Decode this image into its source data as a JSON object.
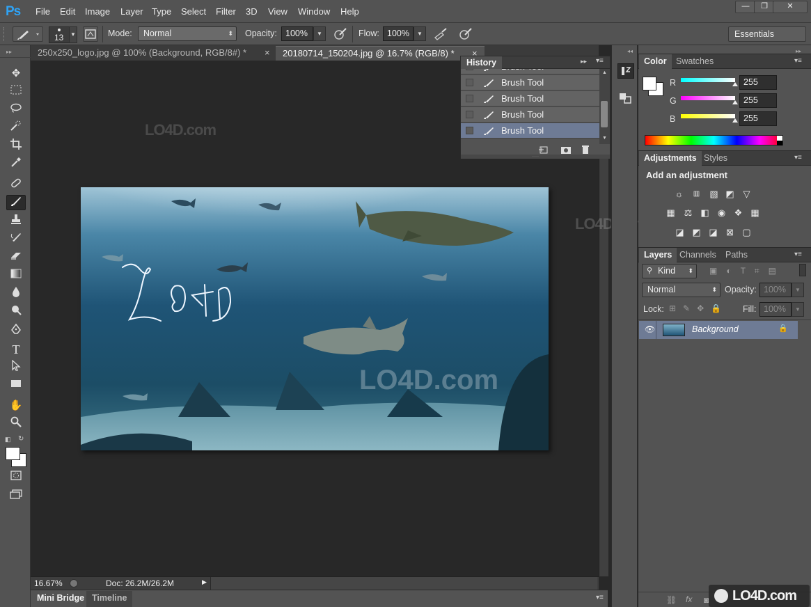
{
  "app": {
    "logo": "Ps"
  },
  "menu": [
    "File",
    "Edit",
    "Image",
    "Layer",
    "Type",
    "Select",
    "Filter",
    "3D",
    "View",
    "Window",
    "Help"
  ],
  "window_controls": {
    "minimize": "—",
    "restore": "❐",
    "close": "✕"
  },
  "options": {
    "brush_size": "13",
    "mode_label": "Mode:",
    "mode_value": "Normal",
    "opacity_label": "Opacity:",
    "opacity_value": "100%",
    "flow_label": "Flow:",
    "flow_value": "100%",
    "workspace": "Essentials"
  },
  "doc_tabs": [
    {
      "label": "250x250_logo.jpg @ 100% (Background, RGB/8#) *",
      "close": "×"
    },
    {
      "label": "20180714_150204.jpg @ 16.7% (RGB/8) *",
      "close": "×"
    }
  ],
  "status": {
    "zoom": "16.67%",
    "doc": "Doc: 26.2M/26.2M"
  },
  "bottom_tabs": [
    "Mini Bridge",
    "Timeline"
  ],
  "history": {
    "title": "History",
    "rows": [
      "Brush Tool",
      "Brush Tool",
      "Brush Tool",
      "Brush Tool",
      "Brush Tool"
    ],
    "selected_index": 4
  },
  "color_panel": {
    "tabs": [
      "Color",
      "Swatches"
    ],
    "r_label": "R",
    "g_label": "G",
    "b_label": "B",
    "r_value": "255",
    "g_value": "255",
    "b_value": "255",
    "r_fraction": 1.0,
    "g_fraction": 1.0,
    "b_fraction": 1.0
  },
  "adjustments": {
    "tabs": [
      "Adjustments",
      "Styles"
    ],
    "heading": "Add an adjustment"
  },
  "layers": {
    "tabs": [
      "Layers",
      "Channels",
      "Paths"
    ],
    "kind": "Kind",
    "blend_mode": "Normal",
    "opacity_label": "Opacity:",
    "opacity_value": "100%",
    "lock_label": "Lock:",
    "fill_label": "Fill:",
    "fill_value": "100%",
    "layer_name": "Background"
  },
  "canvas": {
    "drawn_text": "LO4D"
  },
  "watermark": {
    "text": "LO4D.com"
  },
  "colors": {
    "accent": "#2fa3f5",
    "panel": "#535353",
    "workspace": "#282828",
    "selected_row": "#6e7b95"
  }
}
